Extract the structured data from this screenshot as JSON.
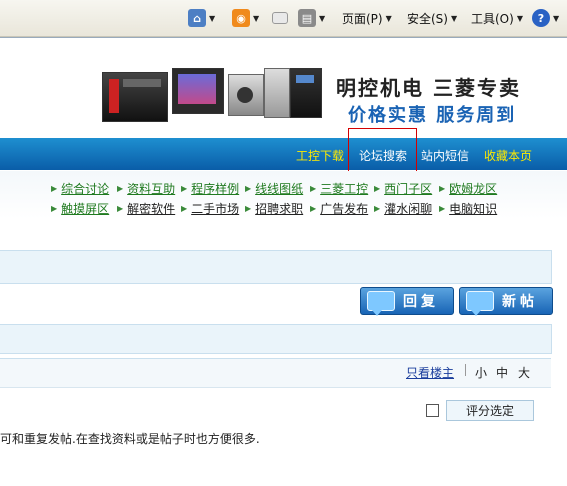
{
  "toolbar": {
    "page_label": "页面(P)",
    "safety_label": "安全(S)",
    "tools_label": "工具(O)"
  },
  "banner": {
    "line1": "明控机电 三菱专卖",
    "line2": "价格实惠 服务周到"
  },
  "nav": {
    "links": [
      "工控下载",
      "论坛搜索",
      "站内短信",
      "收藏本页"
    ],
    "colors": {
      "yellow": "#ffea00",
      "white": "#ffffff"
    }
  },
  "categories": {
    "row1": [
      "综合讨论",
      "资料互助",
      "程序样例",
      "线线图纸",
      "三菱工控",
      "西门子区",
      "欧姆龙区"
    ],
    "row2": [
      "触摸屏区",
      "解密软件",
      "二手市场",
      "招聘求职",
      "广告发布",
      "灌水闲聊",
      "电脑知识"
    ]
  },
  "actions": {
    "reply": "回复",
    "new_post": "新帖"
  },
  "post": {
    "only_op": "只看楼主",
    "font_small": "小",
    "font_medium": "中",
    "font_large": "大",
    "rate_button": "评分选定",
    "body_text": "可和重复发帖.在查找资料或是帖子时也方便很多."
  },
  "colors": {
    "nav_blue": "#0a5da8",
    "highlight_red": "#d40000",
    "brand_blue": "#1a63b4"
  }
}
